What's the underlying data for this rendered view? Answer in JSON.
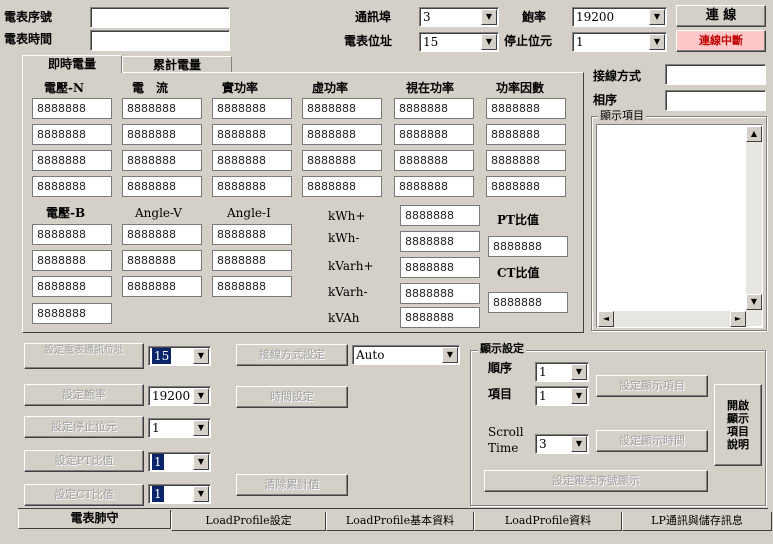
{
  "top": {
    "meter_serial_label": "電表序號",
    "meter_serial_value": "",
    "meter_time_label": "電表時間",
    "meter_time_value": "",
    "comm_port_label": "通訊埠",
    "comm_port_value": "3",
    "baud_label": "鮑率",
    "baud_value": "19200",
    "connect_button": "連 線",
    "meter_addr_label": "電表位址",
    "meter_addr_value": "15",
    "stop_bit_label": "停止位元",
    "stop_bit_value": "1",
    "disconnect_button": "連線中斷",
    "disconnect_color": "#ffc8c8"
  },
  "tabs": [
    {
      "label": "即時電量",
      "active": true
    },
    {
      "label": "累計電量",
      "active": false
    }
  ],
  "realtime": {
    "headers": [
      "電壓-N",
      "電　流",
      "實功率",
      "虛功率",
      "視在功率",
      "功率因數"
    ],
    "rows": [
      [
        "8888888",
        "8888888",
        "8888888",
        "8888888",
        "8888888",
        "8888888"
      ],
      [
        "8888888",
        "8888888",
        "8888888",
        "8888888",
        "8888888",
        "8888888"
      ],
      [
        "8888888",
        "8888888",
        "8888888",
        "8888888",
        "8888888",
        "8888888"
      ],
      [
        "8888888",
        "8888888",
        "8888888",
        "8888888",
        "8888888",
        "8888888"
      ]
    ],
    "lower_headers": [
      "電壓-B",
      "Angle-V",
      "Angle-I"
    ],
    "lower_rows": [
      [
        "8888888",
        "8888888",
        "8888888"
      ],
      [
        "8888888",
        "8888888",
        "8888888"
      ],
      [
        "8888888",
        "8888888",
        "8888888"
      ],
      [
        "8888888"
      ]
    ],
    "energy_labels": [
      "kWh+",
      "kWh-",
      "kVarh+",
      "kVarh-",
      "kVAh"
    ],
    "energy_values": [
      "8888888",
      "8888888",
      "8888888",
      "8888888",
      "8888888"
    ],
    "pt_label": "PT比值",
    "pt_value": "8888888",
    "ct_label": "CT比值",
    "ct_value": "8888888"
  },
  "right_panel": {
    "wiring_label": "接線方式",
    "wiring_value": "",
    "phase_label": "相序",
    "phase_value": "",
    "display_items_label": "顯示項目"
  },
  "settings": {
    "set_addr_button": "設定電表通訊位址",
    "addr_value": "15",
    "set_baud_button": "設定鮑率",
    "baud_value": "19200",
    "set_stopbit_button": "設定停止位元",
    "stopbit_value": "1",
    "set_pt_button": "設定PT比值",
    "pt_value": "1",
    "set_ct_button": "設定CT比值",
    "ct_value": "1",
    "set_wiring_button": "接線方式設定",
    "wiring_value": "Auto",
    "set_time_button": "時間設定",
    "clear_energy_button": "清除累計值"
  },
  "display_settings": {
    "group_label": "顯示設定",
    "order_label": "順序",
    "order_value": "1",
    "item_label": "項目",
    "item_value": "1",
    "set_display_item_button": "設定顯示項目",
    "scroll_time_label_1": "Scroll",
    "scroll_time_label_2": "Time",
    "scroll_time_value": "3",
    "set_display_time_button": "設定顯示時間",
    "set_serial_display_button": "設定電表序號顯示",
    "desc_button": "開啟顯示項目說明"
  },
  "bottom_tabs": [
    "電表肺守",
    "LoadProfile設定",
    "LoadProfile基本資料",
    "LoadProfile資料",
    "LP通訊與儲存訊息"
  ]
}
